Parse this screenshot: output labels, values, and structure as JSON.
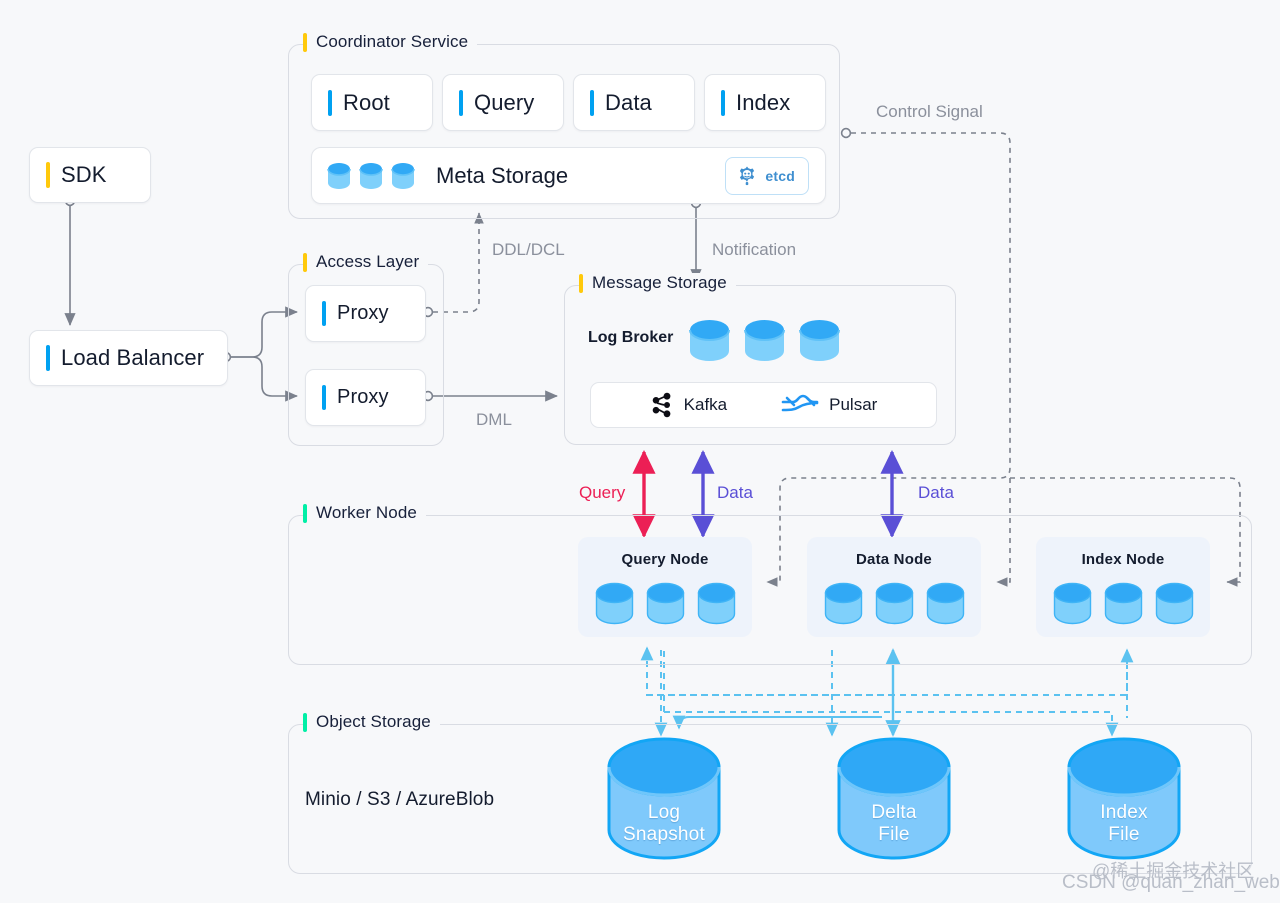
{
  "colors": {
    "yellow": "#FFC90B",
    "blue": "#00A1F1",
    "green": "#00EFA6",
    "query_red": "#EC1F55",
    "data_purple": "#5A4FD6",
    "edge_grey": "#8b909c",
    "cyl_blue": "#29A8F5",
    "etcd_blue": "#3f8fd0"
  },
  "groups": {
    "coordinator": {
      "title": "Coordinator Service",
      "bar": "yellow"
    },
    "access": {
      "title": "Access Layer",
      "bar": "yellow"
    },
    "message": {
      "title": "Message Storage",
      "bar": "yellow"
    },
    "worker": {
      "title": "Worker Node",
      "bar": "green"
    },
    "object": {
      "title": "Object Storage",
      "bar": "green"
    }
  },
  "coordinator": {
    "services": [
      {
        "label": "Root",
        "bar": "blue"
      },
      {
        "label": "Query",
        "bar": "blue"
      },
      {
        "label": "Data",
        "bar": "blue"
      },
      {
        "label": "Index",
        "bar": "blue"
      }
    ],
    "meta_storage": {
      "label": "Meta Storage",
      "cylinder_count": 3,
      "badge": {
        "label": "etcd",
        "icon": "gear-icon"
      }
    }
  },
  "client": {
    "sdk": {
      "label": "SDK",
      "bar": "yellow"
    },
    "load_balancer": {
      "label": "Load Balancer",
      "bar": "blue"
    }
  },
  "access": {
    "proxies": [
      {
        "label": "Proxy",
        "bar": "blue"
      },
      {
        "label": "Proxy",
        "bar": "blue"
      }
    ]
  },
  "message": {
    "log_broker_label": "Log Broker",
    "cylinder_count": 3,
    "brands": [
      {
        "label": "Kafka",
        "icon": "kafka-icon"
      },
      {
        "label": "Pulsar",
        "icon": "pulsar-icon"
      }
    ]
  },
  "worker": {
    "nodes": [
      {
        "title": "Query Node",
        "cylinder_count": 3
      },
      {
        "title": "Data Node",
        "cylinder_count": 3
      },
      {
        "title": "Index Node",
        "cylinder_count": 3
      }
    ]
  },
  "object": {
    "providers": "Minio / S3 / AzureBlob",
    "stores": [
      {
        "label": "Log\nSnapshot"
      },
      {
        "label": "Delta\nFile"
      },
      {
        "label": "Index\nFile"
      }
    ]
  },
  "edges": [
    {
      "id": "control-signal",
      "label": "Control Signal",
      "style": "grey"
    },
    {
      "id": "ddl-dcl",
      "label": "DDL/DCL",
      "style": "grey"
    },
    {
      "id": "notification",
      "label": "Notification",
      "style": "grey"
    },
    {
      "id": "dml",
      "label": "DML",
      "style": "grey"
    },
    {
      "id": "query",
      "label": "Query",
      "style": "query"
    },
    {
      "id": "data-left",
      "label": "Data",
      "style": "data"
    },
    {
      "id": "data-right",
      "label": "Data",
      "style": "data"
    }
  ],
  "watermark": {
    "cn": "@稀土掘金技术社区",
    "csdn": "CSDN @quan_zhan_web"
  }
}
